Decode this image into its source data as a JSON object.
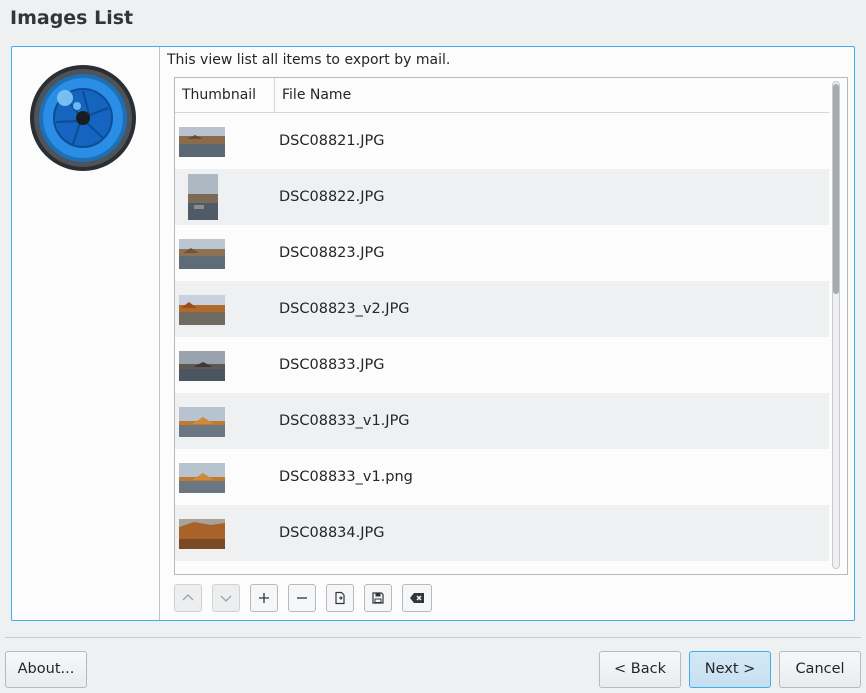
{
  "page": {
    "title": "Images List"
  },
  "description": "This view list all items to export by mail.",
  "list": {
    "columns": [
      "Thumbnail",
      "File Name"
    ],
    "items": [
      {
        "file_name": "DSC08821.JPG",
        "thumb": "lake-landscape",
        "orientation": "landscape"
      },
      {
        "file_name": "DSC08822.JPG",
        "thumb": "lake-portrait",
        "orientation": "portrait"
      },
      {
        "file_name": "DSC08823.JPG",
        "thumb": "lake-landscape",
        "orientation": "landscape"
      },
      {
        "file_name": "DSC08823_v2.JPG",
        "thumb": "lake-landscape-warm",
        "orientation": "landscape"
      },
      {
        "file_name": "DSC08833.JPG",
        "thumb": "lake-cloudy",
        "orientation": "landscape"
      },
      {
        "file_name": "DSC08833_v1.JPG",
        "thumb": "lake-cloudy-warm",
        "orientation": "landscape"
      },
      {
        "file_name": "DSC08833_v1.png",
        "thumb": "lake-cloudy-warm",
        "orientation": "landscape"
      },
      {
        "file_name": "DSC08834.JPG",
        "thumb": "rock-warm",
        "orientation": "landscape"
      }
    ]
  },
  "toolbar": {
    "buttons": [
      {
        "name": "move-up",
        "icon": "chevron-up-icon",
        "enabled": false
      },
      {
        "name": "move-down",
        "icon": "chevron-down-icon",
        "enabled": false
      },
      {
        "name": "add",
        "icon": "plus-icon",
        "enabled": true
      },
      {
        "name": "remove",
        "icon": "minus-icon",
        "enabled": true
      },
      {
        "name": "load",
        "icon": "document-open-icon",
        "enabled": true
      },
      {
        "name": "save",
        "icon": "floppy-disk-icon",
        "enabled": true
      },
      {
        "name": "clear",
        "icon": "clear-backspace-icon",
        "enabled": true
      }
    ]
  },
  "buttons": {
    "about": "About...",
    "back": "< Back",
    "next": "Next >",
    "cancel": "Cancel"
  },
  "colors": {
    "accent": "#3daee9",
    "window_bg": "#eff0f1",
    "view_bg": "#fcfcfc"
  }
}
